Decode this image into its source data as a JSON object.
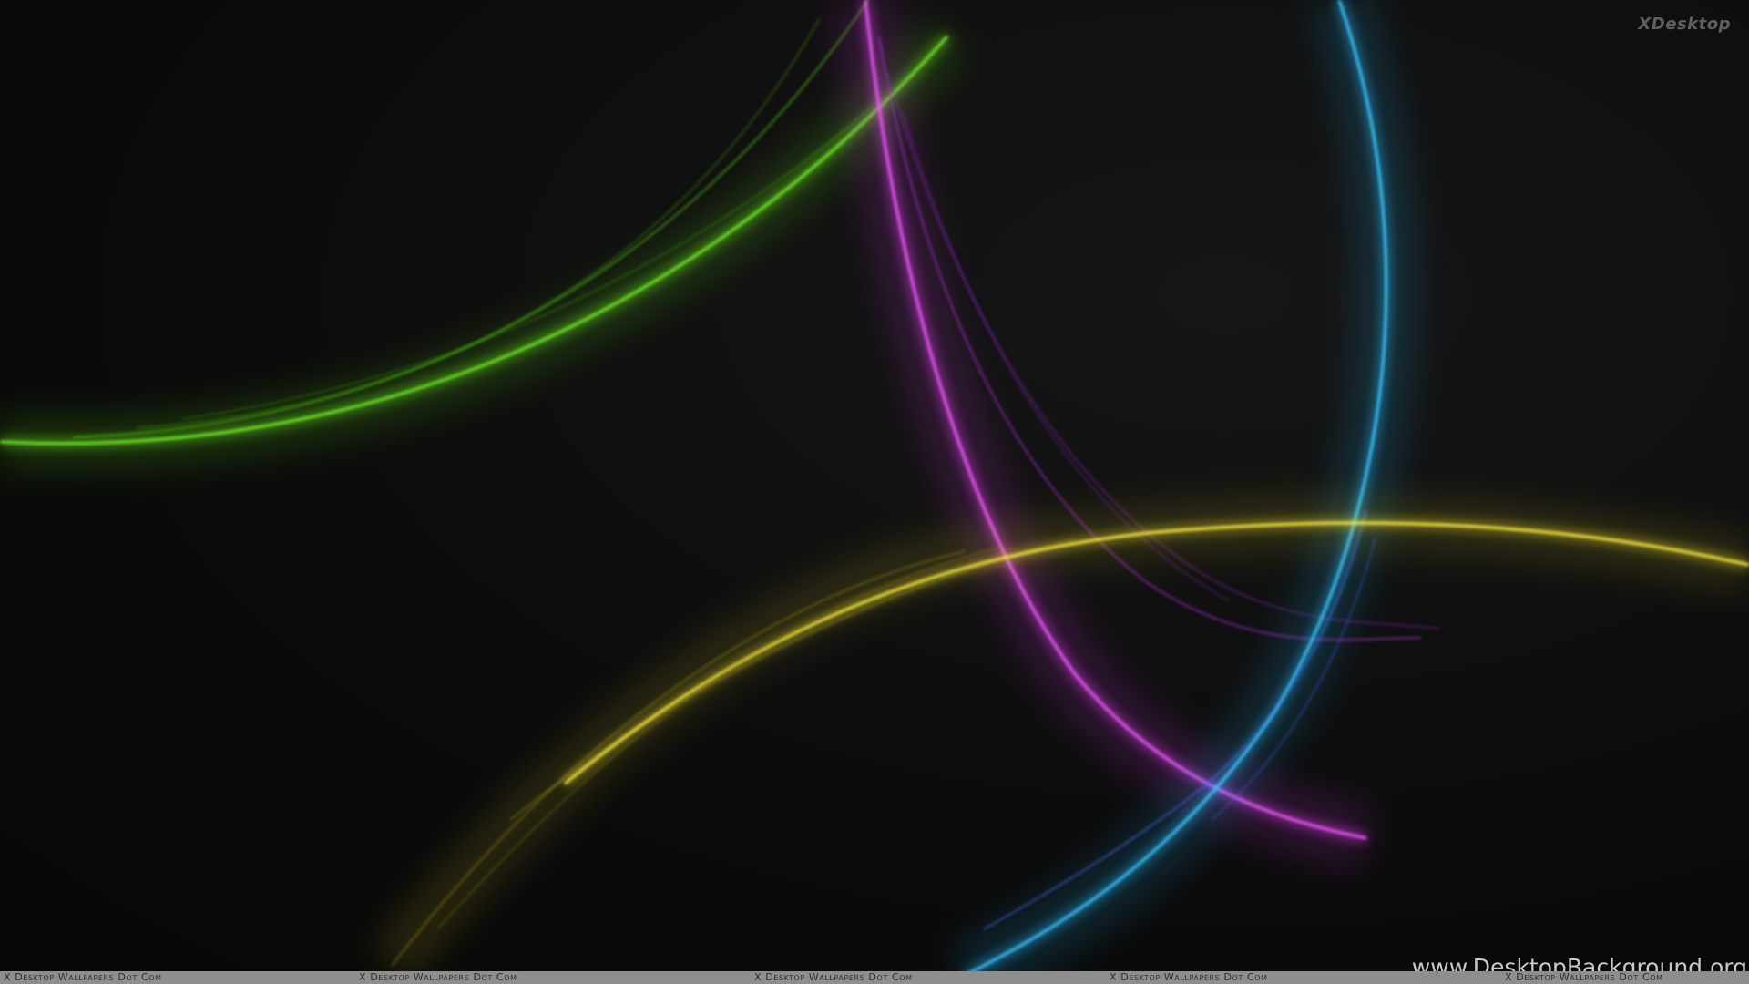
{
  "image": {
    "description_colors": {
      "background": "#0a0a0a",
      "green": "#5fe016",
      "magenta": "#e23ef2",
      "blue": "#22b4f4",
      "yellow": "#f2e226"
    }
  },
  "logo": {
    "text": "XDesktop"
  },
  "footer": {
    "items": [
      "X Desktop Wallpapers Dot Com",
      "X Desktop Wallpapers Dot Com",
      "X Desktop Wallpapers Dot Com",
      "X Desktop Wallpapers Dot Com",
      "X Desktop Wallpapers Dot Com"
    ]
  },
  "watermark": {
    "text": "www.DesktopBackground.org"
  }
}
